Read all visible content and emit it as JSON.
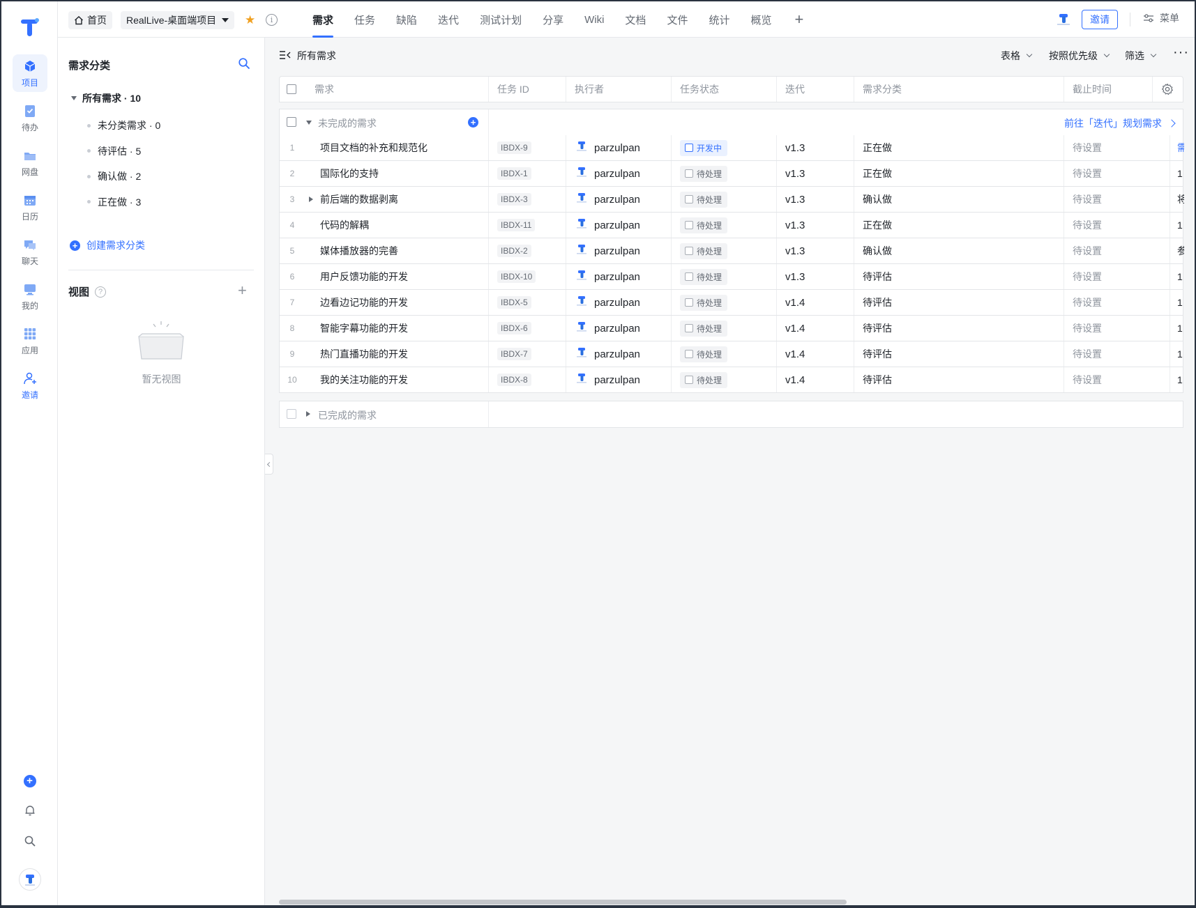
{
  "rail": {
    "items": [
      {
        "label": "项目",
        "icon": "project-icon",
        "active": true
      },
      {
        "label": "待办",
        "icon": "todo-icon"
      },
      {
        "label": "网盘",
        "icon": "drive-icon"
      },
      {
        "label": "日历",
        "icon": "calendar-icon"
      },
      {
        "label": "聊天",
        "icon": "chat-icon"
      },
      {
        "label": "我的",
        "icon": "me-icon"
      },
      {
        "label": "应用",
        "icon": "apps-icon"
      },
      {
        "label": "邀请",
        "icon": "invite-user-icon"
      }
    ]
  },
  "topbar": {
    "home_label": "首页",
    "project_name": "RealLive-桌面端项目",
    "tabs": [
      "需求",
      "任务",
      "缺陷",
      "迭代",
      "测试计划",
      "分享",
      "Wiki",
      "文档",
      "文件",
      "统计",
      "概览"
    ],
    "active_tab": "需求",
    "add_tab": "+",
    "invite_label": "邀请",
    "menu_label": "菜单"
  },
  "panel": {
    "title": "需求分类",
    "root": "所有需求 · 10",
    "categories": [
      "未分类需求 · 0",
      "待评估 · 5",
      "确认做 · 2",
      "正在做 · 3"
    ],
    "create_label": "创建需求分类",
    "views_title": "视图",
    "views_help": "?",
    "views_add": "+",
    "empty_views": "暂无视图"
  },
  "main": {
    "title": "所有需求",
    "controls": {
      "view": "表格",
      "sort": "按照优先级",
      "filter": "筛选",
      "more": "···"
    },
    "columns": {
      "title": "需求",
      "task_id": "任务 ID",
      "executor": "执行者",
      "status": "任务状态",
      "iteration": "迭代",
      "category": "需求分类",
      "due": "截止时间"
    },
    "group_open": "未完成的需求",
    "group_done": "已完成的需求",
    "goto_iteration": "前往「迭代」规划需求",
    "rows": [
      {
        "idx": "1",
        "title": "项目文档的补充和规范化",
        "id": "IBDX-9",
        "executor": "parzulpan",
        "status": "开发中",
        "iteration": "v1.3",
        "category": "正在做",
        "due": "待设置",
        "extra": "需"
      },
      {
        "idx": "2",
        "title": "国际化的支持",
        "id": "IBDX-1",
        "executor": "parzulpan",
        "status": "待处理",
        "iteration": "v1.3",
        "category": "正在做",
        "due": "待设置",
        "extra": "1"
      },
      {
        "idx": "3",
        "title": "前后端的数据剥离",
        "id": "IBDX-3",
        "executor": "parzulpan",
        "status": "待处理",
        "iteration": "v1.3",
        "category": "确认做",
        "due": "待设置",
        "extra": "将"
      },
      {
        "idx": "4",
        "title": "代码的解耦",
        "id": "IBDX-11",
        "executor": "parzulpan",
        "status": "待处理",
        "iteration": "v1.3",
        "category": "正在做",
        "due": "待设置",
        "extra": "1"
      },
      {
        "idx": "5",
        "title": "媒体播放器的完善",
        "id": "IBDX-2",
        "executor": "parzulpan",
        "status": "待处理",
        "iteration": "v1.3",
        "category": "确认做",
        "due": "待设置",
        "extra": "参"
      },
      {
        "idx": "6",
        "title": "用户反馈功能的开发",
        "id": "IBDX-10",
        "executor": "parzulpan",
        "status": "待处理",
        "iteration": "v1.3",
        "category": "待评估",
        "due": "待设置",
        "extra": "1"
      },
      {
        "idx": "7",
        "title": "边看边记功能的开发",
        "id": "IBDX-5",
        "executor": "parzulpan",
        "status": "待处理",
        "iteration": "v1.4",
        "category": "待评估",
        "due": "待设置",
        "extra": "1"
      },
      {
        "idx": "8",
        "title": "智能字幕功能的开发",
        "id": "IBDX-6",
        "executor": "parzulpan",
        "status": "待处理",
        "iteration": "v1.4",
        "category": "待评估",
        "due": "待设置",
        "extra": "1"
      },
      {
        "idx": "9",
        "title": "热门直播功能的开发",
        "id": "IBDX-7",
        "executor": "parzulpan",
        "status": "待处理",
        "iteration": "v1.4",
        "category": "待评估",
        "due": "待设置",
        "extra": "1"
      },
      {
        "idx": "10",
        "title": "我的关注功能的开发",
        "id": "IBDX-8",
        "executor": "parzulpan",
        "status": "待处理",
        "iteration": "v1.4",
        "category": "待评估",
        "due": "待设置",
        "extra": "1"
      }
    ]
  },
  "colors": {
    "accent": "#3370ff",
    "star": "#f0a020",
    "dev_status_bg": "#eaf1ff"
  }
}
